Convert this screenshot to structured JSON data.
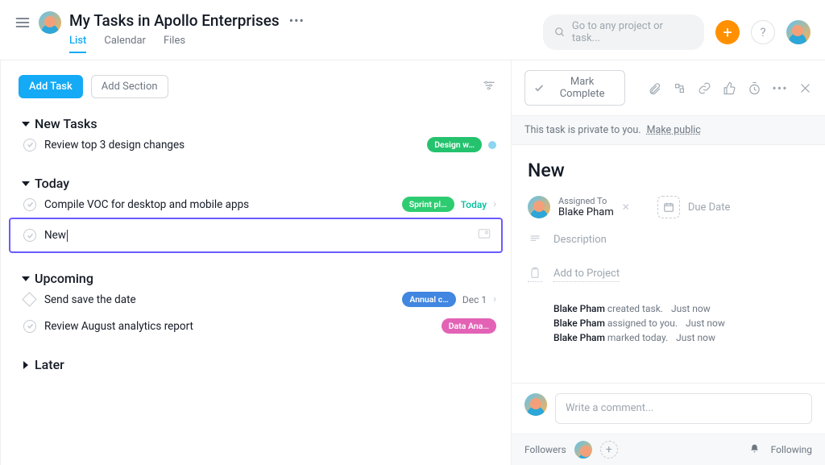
{
  "header": {
    "title": "My Tasks in Apollo Enterprises",
    "tabs": {
      "list": "List",
      "calendar": "Calendar",
      "files": "Files"
    },
    "search_placeholder": "Go to any project or task...",
    "help_glyph": "?",
    "add_glyph": "+"
  },
  "list": {
    "add_task": "Add Task",
    "add_section": "Add Section",
    "sections": {
      "new_tasks": {
        "title": "New Tasks",
        "task0": {
          "name": "Review top 3 design changes",
          "pill": "Design w…"
        }
      },
      "today": {
        "title": "Today",
        "task0": {
          "name": "Compile VOC for desktop and mobile apps",
          "pill": "Sprint pl…",
          "due": "Today"
        },
        "task_new": {
          "name": "New"
        }
      },
      "upcoming": {
        "title": "Upcoming",
        "task0": {
          "name": "Send save the date",
          "pill": "Annual c…",
          "due": "Dec 1"
        },
        "task1": {
          "name": "Review August analytics report",
          "pill": "Data Ana…"
        }
      },
      "later": {
        "title": "Later"
      }
    }
  },
  "detail": {
    "mark_complete": "Mark Complete",
    "privacy_text": "This task is private to you.",
    "privacy_link": "Make public",
    "title": "New",
    "assigned_label": "Assigned To",
    "assigned_value": "Blake Pham",
    "due_label": "Due Date",
    "description_label": "Description",
    "add_project_label": "Add to Project",
    "activity": {
      "l1_who": "Blake Pham",
      "l1_what": "created task.",
      "l1_ts": "Just now",
      "l2_who": "Blake Pham",
      "l2_what": "assigned to you.",
      "l2_ts": "Just now",
      "l3_who": "Blake Pham",
      "l3_what": "marked today.",
      "l3_ts": "Just now"
    },
    "comment_placeholder": "Write a comment...",
    "followers_label": "Followers",
    "following_label": "Following"
  }
}
